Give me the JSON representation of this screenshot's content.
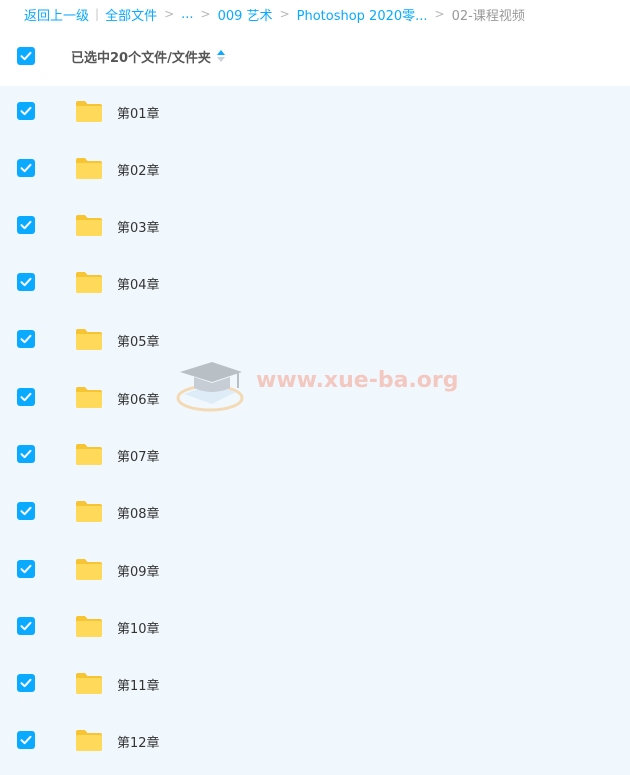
{
  "breadcrumb": {
    "back": "返回上一级",
    "all_files": "全部文件",
    "ellipsis": "...",
    "art": "009 艺术",
    "photoshop": "Photoshop 2020零...",
    "current": "02-课程视频"
  },
  "header": {
    "selection_label": "已选中20个文件/文件夹",
    "sort_icon": "sort-icon",
    "select_all_checked": true
  },
  "files": [
    {
      "name": "第01章",
      "checked": true,
      "icon": "folder-icon"
    },
    {
      "name": "第02章",
      "checked": true,
      "icon": "folder-icon"
    },
    {
      "name": "第03章",
      "checked": true,
      "icon": "folder-icon"
    },
    {
      "name": "第04章",
      "checked": true,
      "icon": "folder-icon"
    },
    {
      "name": "第05章",
      "checked": true,
      "icon": "folder-icon"
    },
    {
      "name": "第06章",
      "checked": true,
      "icon": "folder-icon"
    },
    {
      "name": "第07章",
      "checked": true,
      "icon": "folder-icon"
    },
    {
      "name": "第08章",
      "checked": true,
      "icon": "folder-icon"
    },
    {
      "name": "第09章",
      "checked": true,
      "icon": "folder-icon"
    },
    {
      "name": "第10章",
      "checked": true,
      "icon": "folder-icon"
    },
    {
      "name": "第11章",
      "checked": true,
      "icon": "folder-icon"
    },
    {
      "name": "第12章",
      "checked": true,
      "icon": "folder-icon"
    }
  ],
  "watermark": {
    "text": "www.xue-ba.org",
    "icon": "graduation-cap-icon"
  },
  "colors": {
    "accent": "#09aaff",
    "list_background": "#f1f8fd",
    "folder": "#ffd24d",
    "watermark_text": "#f4a28f"
  }
}
